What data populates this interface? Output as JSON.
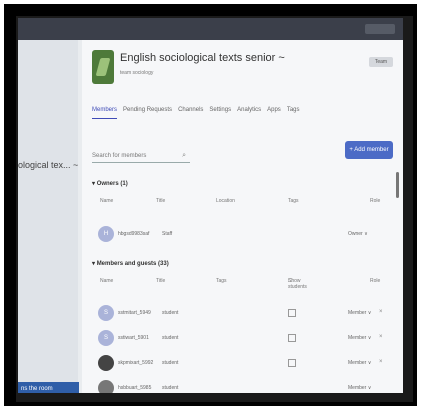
{
  "app": {
    "team_name": "English sociological texts senior ~",
    "team_subtitle": "team sociology",
    "team_button": "Team"
  },
  "sidebar": {
    "truncated_title": "ological tex... ~",
    "bottom_link": "ns the room"
  },
  "tabs": [
    {
      "label": "Members"
    },
    {
      "label": "Pending Requests"
    },
    {
      "label": "Channels"
    },
    {
      "label": "Settings"
    },
    {
      "label": "Analytics"
    },
    {
      "label": "Apps"
    },
    {
      "label": "Tags"
    }
  ],
  "search": {
    "placeholder": "Search for members"
  },
  "add_member_label": "Add member",
  "owners": {
    "heading": "Owners (1)",
    "columns": {
      "name": "Name",
      "title": "Title",
      "location": "Location",
      "tags": "Tags",
      "role": "Role"
    },
    "rows": [
      {
        "name": "hbgsd9983saf",
        "title": "Staff",
        "role": "Owner ∨"
      }
    ]
  },
  "members": {
    "heading": "Members and guests (33)",
    "columns": {
      "name": "Name",
      "title": "Title",
      "tags": "Tags",
      "show_students": "Show students",
      "role": "Role"
    },
    "rows": [
      {
        "avatar": "S",
        "name": "sstmitart_5949",
        "title": "student",
        "role": "Member ∨"
      },
      {
        "avatar": "S",
        "name": "sstiwart_5901",
        "title": "student",
        "role": "Member ∨"
      },
      {
        "avatar": "",
        "name": "skpmixart_5992",
        "title": "student",
        "role": "Member ∨"
      },
      {
        "avatar": "",
        "name": "hsbbuart_5985",
        "title": "student",
        "role": "Member ∨"
      }
    ]
  }
}
